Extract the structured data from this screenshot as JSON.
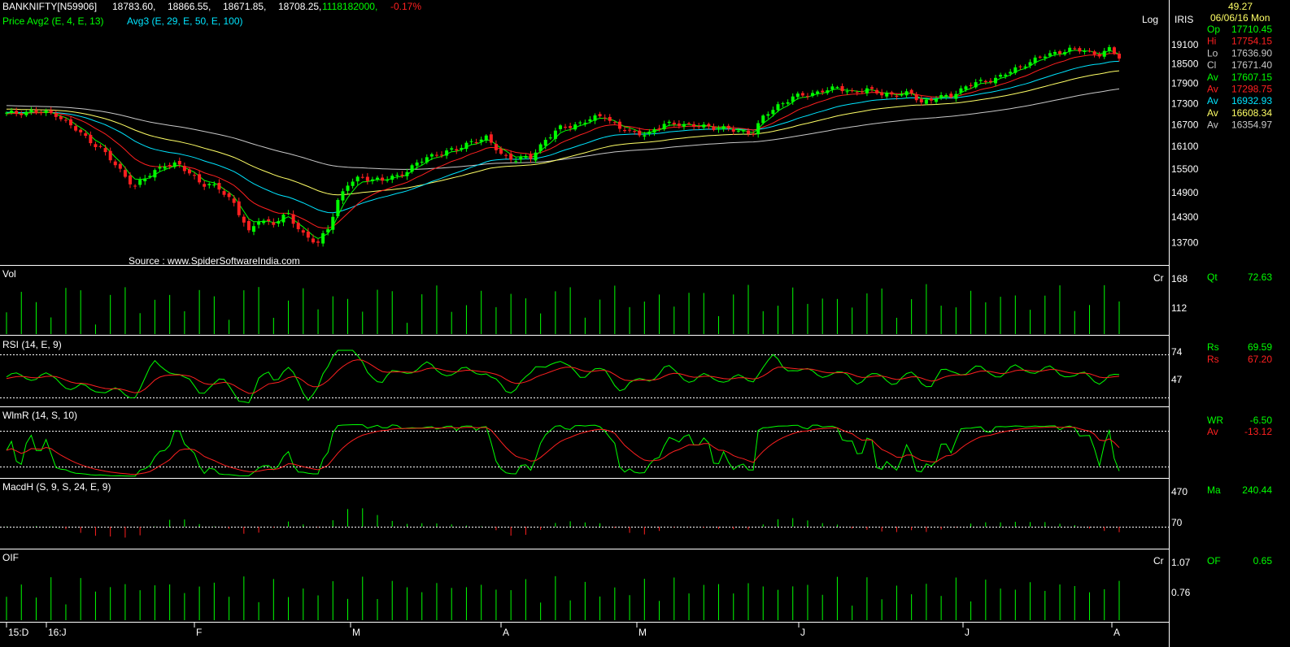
{
  "header": {
    "symbol": "BANKNIFTY[N59906]",
    "open": "18783.60,",
    "high": "18866.55,",
    "low": "18671.85,",
    "close": "18708.25,",
    "volume": "1118182000,",
    "change": "-0.17%",
    "ind_avg2": "Price Avg2 (E, 4, E, 13)",
    "ind_avg3": "Avg3 (E, 29, E, 50, E, 100)",
    "log_label": "Log",
    "iris_label": "IRIS",
    "source": "Source : www.SpiderSoftwareIndia.com"
  },
  "info": {
    "top_value": "49.27",
    "date": "06/06/16 Mon",
    "rows": [
      {
        "label": "Op",
        "value": "17710.45",
        "color": "#00ff00"
      },
      {
        "label": "Hi",
        "value": "17754.15",
        "color": "#ff2020"
      },
      {
        "label": "Lo",
        "value": "17636.90",
        "color": "#c8c8c8"
      },
      {
        "label": "Cl",
        "value": "17671.40",
        "color": "#c8c8c8"
      },
      {
        "label": "Av",
        "value": "17607.15",
        "color": "#00ff00"
      },
      {
        "label": "Av",
        "value": "17298.75",
        "color": "#ff2020"
      },
      {
        "label": "Av",
        "value": "16932.93",
        "color": "#00e5ff"
      },
      {
        "label": "Av",
        "value": "16608.34",
        "color": "#ffff66"
      },
      {
        "label": "Av",
        "value": "16354.97",
        "color": "#c8c8c8"
      }
    ]
  },
  "panels": {
    "vol": {
      "title": "Vol",
      "unit": "Cr",
      "ticks": [
        "168",
        "112"
      ],
      "readout_label": "Qt",
      "readout_value": "72.63"
    },
    "rsi": {
      "title": "RSI (14, E, 9)",
      "ticks": [
        "74",
        "47"
      ],
      "readouts": [
        {
          "label": "Rs",
          "value": "69.59",
          "color": "#00ff00"
        },
        {
          "label": "Rs",
          "value": "67.20",
          "color": "#ff2020"
        }
      ]
    },
    "wlmr": {
      "title": "WlmR (14, S, 10)",
      "readouts": [
        {
          "label": "WR",
          "value": "-6.50",
          "color": "#00ff00"
        },
        {
          "label": "Av",
          "value": "-13.12",
          "color": "#ff2020"
        }
      ]
    },
    "macd": {
      "title": "MacdH (S, 9, S, 24, E, 9)",
      "ticks": [
        "470",
        "70"
      ],
      "readout_label": "Ma",
      "readout_value": "240.44"
    },
    "oif": {
      "title": "OIF",
      "unit": "Cr",
      "ticks": [
        "1.07",
        "0.76"
      ],
      "readout_label": "OF",
      "readout_value": "0.65"
    }
  },
  "x_axis_labels": [
    "15:D",
    "16:J",
    "F",
    "M",
    "A",
    "M",
    "J",
    "J",
    "A"
  ],
  "chart_data": {
    "type": "line",
    "title": "BANKNIFTY[N59906]",
    "yscale": "log",
    "ylim": [
      13300,
      19500
    ],
    "y_ticks": [
      19100,
      18500,
      17900,
      17300,
      16700,
      16100,
      15500,
      14900,
      14300,
      13700
    ],
    "x_tick_labels": [
      "15:D",
      "16:J",
      "F",
      "M",
      "A",
      "M",
      "J",
      "J",
      "A"
    ],
    "grid": false,
    "anchor_closes": [
      [
        0,
        17010
      ],
      [
        5,
        17080
      ],
      [
        10,
        17000
      ],
      [
        15,
        16450
      ],
      [
        19,
        16050
      ],
      [
        22,
        15600
      ],
      [
        26,
        15050
      ],
      [
        29,
        15350
      ],
      [
        32,
        15640
      ],
      [
        35,
        15580
      ],
      [
        38,
        15300
      ],
      [
        40,
        15100
      ],
      [
        43,
        15000
      ],
      [
        46,
        14650
      ],
      [
        49,
        13900
      ],
      [
        51,
        14250
      ],
      [
        54,
        14150
      ],
      [
        57,
        14350
      ],
      [
        60,
        13900
      ],
      [
        63,
        13650
      ],
      [
        65,
        14050
      ],
      [
        67,
        14700
      ],
      [
        69,
        15100
      ],
      [
        72,
        15300
      ],
      [
        76,
        15200
      ],
      [
        79,
        15320
      ],
      [
        82,
        15550
      ],
      [
        85,
        15800
      ],
      [
        88,
        15950
      ],
      [
        91,
        16000
      ],
      [
        94,
        16250
      ],
      [
        97,
        16320
      ],
      [
        100,
        15900
      ],
      [
        103,
        15750
      ],
      [
        106,
        15800
      ],
      [
        109,
        16300
      ],
      [
        112,
        16600
      ],
      [
        115,
        16700
      ],
      [
        118,
        16850
      ],
      [
        121,
        16950
      ],
      [
        124,
        16600
      ],
      [
        127,
        16450
      ],
      [
        130,
        16480
      ],
      [
        133,
        16700
      ],
      [
        136,
        16750
      ],
      [
        139,
        16650
      ],
      [
        142,
        16650
      ],
      [
        145,
        16600
      ],
      [
        148,
        16500
      ],
      [
        151,
        16500
      ],
      [
        153,
        16900
      ],
      [
        156,
        17250
      ],
      [
        159,
        17500
      ],
      [
        162,
        17550
      ],
      [
        165,
        17700
      ],
      [
        168,
        17750
      ],
      [
        171,
        17650
      ],
      [
        174,
        17700
      ],
      [
        177,
        17600
      ],
      [
        180,
        17550
      ],
      [
        183,
        17600
      ],
      [
        185,
        17350
      ],
      [
        188,
        17450
      ],
      [
        191,
        17550
      ],
      [
        194,
        17800
      ],
      [
        197,
        17950
      ],
      [
        200,
        18050
      ],
      [
        203,
        18250
      ],
      [
        206,
        18500
      ],
      [
        209,
        18700
      ],
      [
        212,
        18850
      ],
      [
        215,
        18950
      ],
      [
        218,
        18900
      ],
      [
        221,
        18800
      ],
      [
        223,
        18950
      ],
      [
        225,
        18700
      ]
    ],
    "series": [
      {
        "name": "Avg2 4",
        "color": "#00ff00",
        "note": "price EMA 4"
      },
      {
        "name": "Avg2 13",
        "color": "#ff2020",
        "note": "price EMA 13"
      },
      {
        "name": "Avg3 29",
        "color": "#00e5ff"
      },
      {
        "name": "Avg3 50",
        "color": "#ffff66"
      },
      {
        "name": "Avg3 100",
        "color": "#c8c8c8"
      }
    ],
    "latest_averages": {
      "avg4": 17607.15,
      "avg13": 17298.75,
      "avg29": 16932.93,
      "avg50": 16608.34,
      "avg100": 16354.97
    },
    "indicator_latest": {
      "volume_qt": 72.63,
      "rsi": 69.59,
      "rsi_signal": 67.2,
      "williams_r": -6.5,
      "williams_r_avg": -13.12,
      "macd_hist": 240.44,
      "oif": 0.65
    }
  }
}
